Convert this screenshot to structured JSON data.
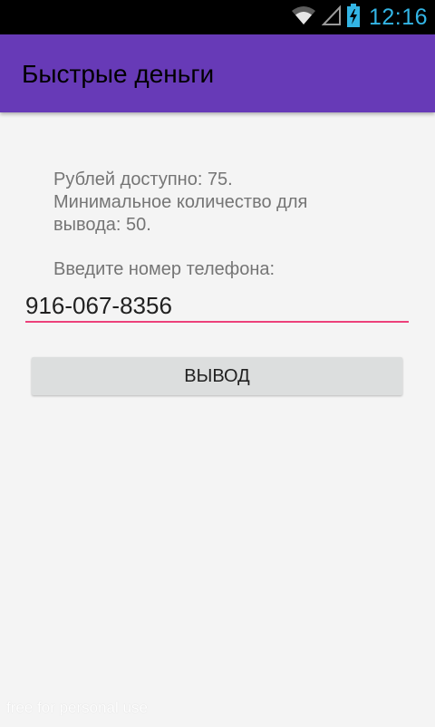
{
  "status_bar": {
    "time": "12:16",
    "time_color": "#33b5e5",
    "icons": [
      "wifi-icon",
      "signal-icon",
      "battery-charging-icon"
    ]
  },
  "app_bar": {
    "title": "Быстрые деньги",
    "color": "#673ab7"
  },
  "main": {
    "info_text": "Рублей доступно: 75.\nМинимальное количество для\nвывода: 50.",
    "phone_label": "Введите номер телефона:",
    "phone_value": "916-067-8356",
    "underline_color": "#ec407a",
    "withdraw_label": "ВЫВОД"
  },
  "watermark": "free for personal use"
}
